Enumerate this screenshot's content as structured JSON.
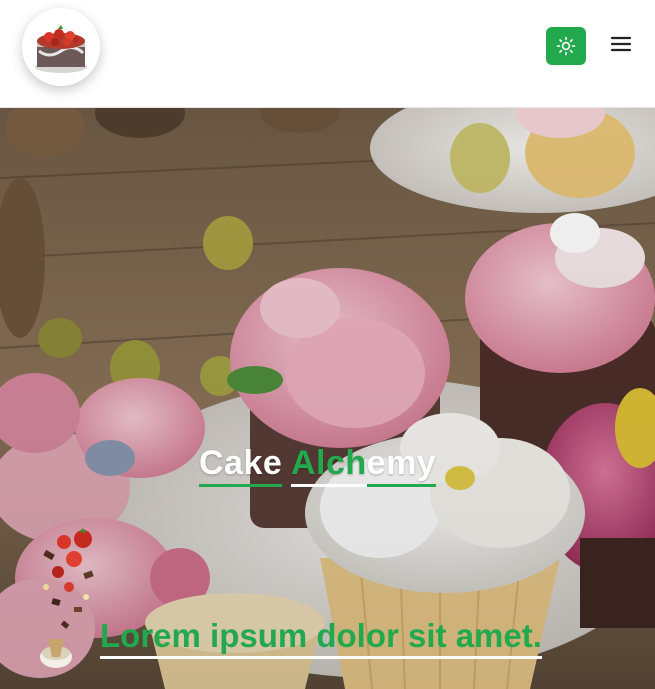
{
  "header": {
    "logo_icon": "cake-logo-icon",
    "theme_toggle_icon": "sun-icon",
    "menu_icon": "hamburger-menu-icon"
  },
  "hero": {
    "title_word_1": "Cake",
    "title_word_2": "Alch",
    "title_word_3": "emy",
    "subtitle": "Lorem ipsum dolor sit amet.",
    "decoration_icon": "falling-strawberries-icon"
  },
  "colors": {
    "accent": "#22a94d",
    "white": "#ffffff"
  }
}
